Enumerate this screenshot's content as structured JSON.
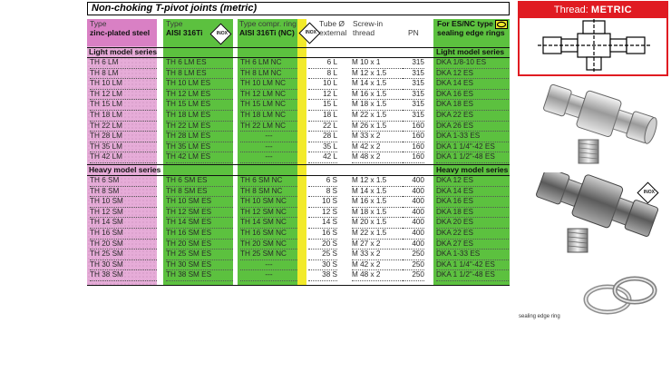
{
  "title": "Non-choking T-pivot joints (metric)",
  "thread_box": {
    "label": "Thread:",
    "value": "METRIC"
  },
  "inox_badge": "INOX",
  "headers": {
    "c1_line1": "Type",
    "c1_line2": "zinc-plated steel",
    "c2_line1": "Type",
    "c2_line2": "AISI 316Ti",
    "c3_line1": "Type compr. ring",
    "c3_line2": "AISI 316Ti (NC)",
    "c4_line1": "Tube Ø",
    "c4_line2": "external",
    "c5_line1": "Screw-in",
    "c5_line2": "thread",
    "c6": "PN",
    "c7_line1": "For ES/NC type",
    "c7_line2": "sealing edge rings"
  },
  "sections": {
    "light": "Light model series",
    "heavy": "Heavy model series"
  },
  "light_rows": [
    {
      "c1": "TH 6 LM",
      "c2": "TH 6 LM ES",
      "c3": "TH 6 LM NC",
      "tube": "6 L",
      "thread": "M 10 x 1",
      "pn": "315",
      "seal": "DKA 1/8-10 ES"
    },
    {
      "c1": "TH 8 LM",
      "c2": "TH 8 LM ES",
      "c3": "TH 8 LM NC",
      "tube": "8 L",
      "thread": "M 12 x 1.5",
      "pn": "315",
      "seal": "DKA 12 ES"
    },
    {
      "c1": "TH 10 LM",
      "c2": "TH 10 LM ES",
      "c3": "TH 10 LM NC",
      "tube": "10 L",
      "thread": "M 14 x 1.5",
      "pn": "315",
      "seal": "DKA 14 ES"
    },
    {
      "c1": "TH 12 LM",
      "c2": "TH 12 LM ES",
      "c3": "TH 12 LM NC",
      "tube": "12 L",
      "thread": "M 16 x 1.5",
      "pn": "315",
      "seal": "DKA 16 ES"
    },
    {
      "c1": "TH 15 LM",
      "c2": "TH 15 LM ES",
      "c3": "TH 15 LM NC",
      "tube": "15 L",
      "thread": "M 18 x 1.5",
      "pn": "315",
      "seal": "DKA 18 ES"
    },
    {
      "c1": "TH 18 LM",
      "c2": "TH 18 LM ES",
      "c3": "TH 18 LM NC",
      "tube": "18 L",
      "thread": "M 22 x 1.5",
      "pn": "315",
      "seal": "DKA 22 ES"
    },
    {
      "c1": "TH 22 LM",
      "c2": "TH 22 LM ES",
      "c3": "TH 22 LM NC",
      "tube": "22 L",
      "thread": "M 26 x 1.5",
      "pn": "160",
      "seal": "DKA 26 ES"
    },
    {
      "c1": "TH 28 LM",
      "c2": "TH 28 LM ES",
      "c3": "---",
      "tube": "28 L",
      "thread": "M 33 x 2",
      "pn": "160",
      "seal": "DKA 1-33 ES"
    },
    {
      "c1": "TH 35 LM",
      "c2": "TH 35 LM ES",
      "c3": "---",
      "tube": "35 L",
      "thread": "M 42 x 2",
      "pn": "160",
      "seal": "DKA 1 1/4\"-42 ES"
    },
    {
      "c1": "TH 42 LM",
      "c2": "TH 42 LM ES",
      "c3": "---",
      "tube": "42 L",
      "thread": "M 48 x 2",
      "pn": "160",
      "seal": "DKA 1 1/2\"-48 ES"
    }
  ],
  "heavy_rows": [
    {
      "c1": "TH 6 SM",
      "c2": "TH 6 SM ES",
      "c3": "TH 6 SM NC",
      "tube": "6 S",
      "thread": "M 12 x 1.5",
      "pn": "400",
      "seal": "DKA 12 ES"
    },
    {
      "c1": "TH 8 SM",
      "c2": "TH 8 SM ES",
      "c3": "TH 8 SM NC",
      "tube": "8 S",
      "thread": "M 14 x 1.5",
      "pn": "400",
      "seal": "DKA 14 ES"
    },
    {
      "c1": "TH 10 SM",
      "c2": "TH 10 SM ES",
      "c3": "TH 10 SM NC",
      "tube": "10 S",
      "thread": "M 16 x 1.5",
      "pn": "400",
      "seal": "DKA 16 ES"
    },
    {
      "c1": "TH 12 SM",
      "c2": "TH 12 SM ES",
      "c3": "TH 12 SM NC",
      "tube": "12 S",
      "thread": "M 18 x 1.5",
      "pn": "400",
      "seal": "DKA 18 ES"
    },
    {
      "c1": "TH 14 SM",
      "c2": "TH 14 SM ES",
      "c3": "TH 14 SM NC",
      "tube": "14 S",
      "thread": "M 20 x 1.5",
      "pn": "400",
      "seal": "DKA 20 ES"
    },
    {
      "c1": "TH 16 SM",
      "c2": "TH 16 SM ES",
      "c3": "TH 16 SM NC",
      "tube": "16 S",
      "thread": "M 22 x 1.5",
      "pn": "400",
      "seal": "DKA 22 ES"
    },
    {
      "c1": "TH 20 SM",
      "c2": "TH 20 SM ES",
      "c3": "TH 20 SM NC",
      "tube": "20 S",
      "thread": "M 27 x 2",
      "pn": "400",
      "seal": "DKA 27 ES"
    },
    {
      "c1": "TH 25 SM",
      "c2": "TH 25 SM ES",
      "c3": "TH 25 SM NC",
      "tube": "25 S",
      "thread": "M 33 x 2",
      "pn": "250",
      "seal": "DKA 1-33 ES"
    },
    {
      "c1": "TH 30 SM",
      "c2": "TH 30 SM ES",
      "c3": "---",
      "tube": "30 S",
      "thread": "M 42 x 2",
      "pn": "250",
      "seal": "DKA 1 1/4\"-42 ES"
    },
    {
      "c1": "TH 38 SM",
      "c2": "TH 38 SM ES",
      "c3": "---",
      "tube": "38 S",
      "thread": "M 48 x 2",
      "pn": "250",
      "seal": "DKA 1 1/2\"-48 ES"
    }
  ],
  "caption": "sealing edge ring",
  "colors": {
    "pink": "#d980c4",
    "green": "#5cc13f",
    "yellow": "#f2ea2a",
    "red": "#e01b22"
  }
}
